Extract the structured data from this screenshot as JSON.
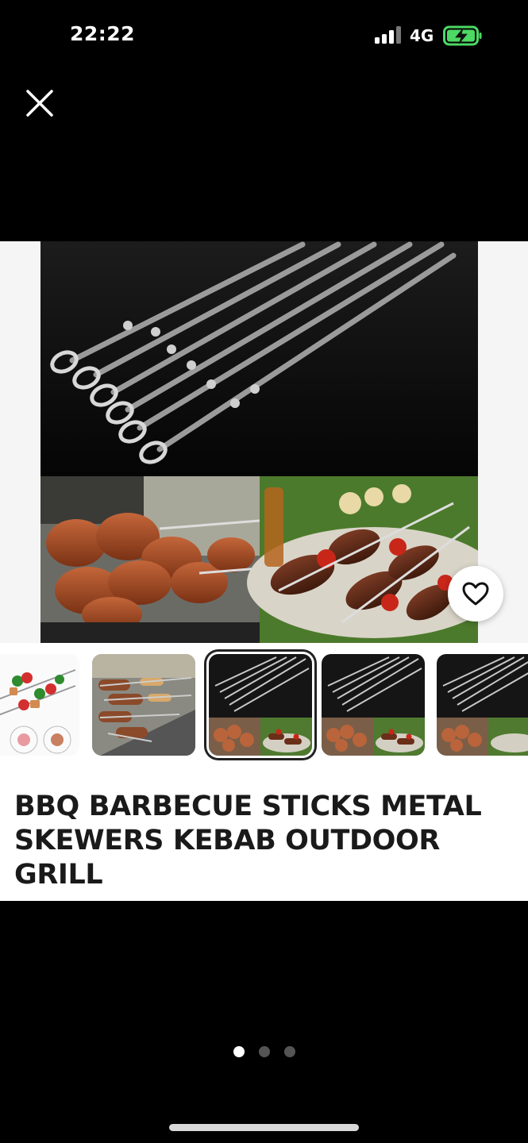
{
  "status_bar": {
    "time": "22:22",
    "network": "4G",
    "signal_icon": "signal-bars-icon",
    "battery_icon": "battery-charging-icon",
    "battery_color": "#4cd964"
  },
  "toolbar": {
    "close_icon": "close-icon"
  },
  "product": {
    "title": "BBQ BARBECUE STICKS METAL SKEWERS KEBAB OUTDOOR GRILL",
    "favorite_icon": "heart-outline-icon"
  },
  "gallery": {
    "thumbnail_count": 5,
    "selected_thumbnail": 3
  },
  "pager": {
    "page_count": 3,
    "current_page": 1
  }
}
